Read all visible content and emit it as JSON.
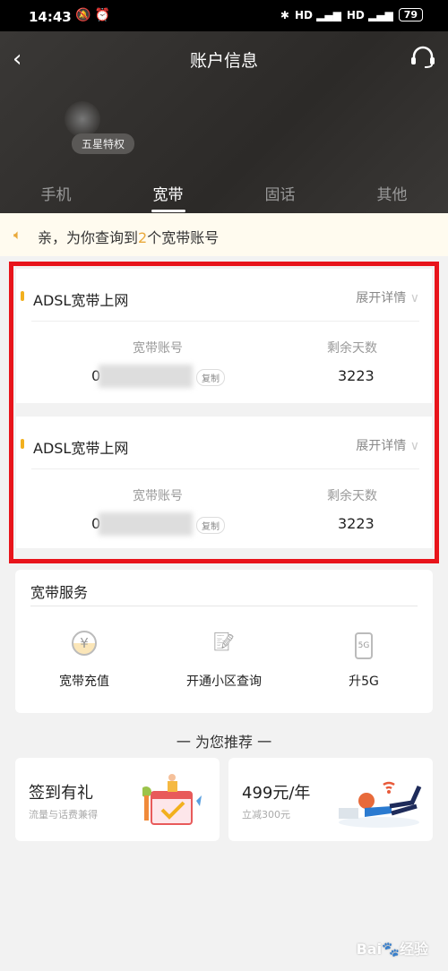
{
  "status_bar": {
    "time": "14:43",
    "battery": "79",
    "network": "4G"
  },
  "header": {
    "title": "账户信息",
    "badge": "五星特权"
  },
  "tabs": [
    {
      "label": "手机"
    },
    {
      "label": "宽带",
      "active": true
    },
    {
      "label": "固话"
    },
    {
      "label": "其他"
    }
  ],
  "notice": {
    "prefix": "亲，为你查询到",
    "count": "2",
    "suffix": "个宽带账号"
  },
  "accounts": [
    {
      "title": "ADSL宽带上网",
      "expand": "展开详情",
      "account_label": "宽带账号",
      "account_value": "0",
      "copy": "复制",
      "days_label": "剩余天数",
      "days_value": "3223"
    },
    {
      "title": "ADSL宽带上网",
      "expand": "展开详情",
      "account_label": "宽带账号",
      "account_value": "0",
      "copy": "复制",
      "days_label": "剩余天数",
      "days_value": "3223"
    }
  ],
  "services": {
    "title": "宽带服务",
    "items": [
      {
        "label": "宽带充值",
        "icon": "yuan-coin-icon"
      },
      {
        "label": "开通小区查询",
        "icon": "edit-document-icon"
      },
      {
        "label": "升5G",
        "icon": "phone-5g-icon"
      }
    ]
  },
  "recommend": {
    "title": "一 为您推荐 一",
    "cards": [
      {
        "title": "签到有礼",
        "subtitle": "流量与话费兼得"
      },
      {
        "title": "499元/年",
        "subtitle": "立减300元"
      }
    ]
  },
  "watermark": "Bai经验",
  "colors": {
    "accent": "#f2b01e",
    "highlight": "#e8141b",
    "header_bg": "#2e2c2a"
  }
}
